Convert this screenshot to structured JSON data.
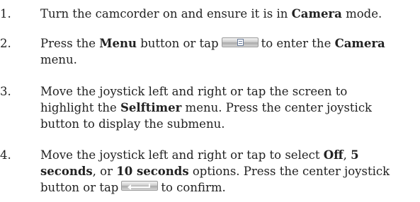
{
  "steps": [
    {
      "number": "1.",
      "line1": {
        "pre": "Turn the camcorder on and ensure it is in ",
        "bold": "Camera",
        "post": " mode."
      }
    },
    {
      "number": "2.",
      "line1": {
        "pre": "Press the ",
        "bold1": "Menu",
        "mid": " button or tap",
        "post": "to enter the ",
        "bold2": "Camera"
      },
      "line2": "menu.",
      "icon": "menu-document-icon"
    },
    {
      "number": "3.",
      "line1": "Move the joystick left and right or tap the screen to",
      "line2": {
        "pre": "highlight the ",
        "bold": "Selftimer",
        "post": " menu. Press the center joystick"
      },
      "line3": "button to display the submenu."
    },
    {
      "number": "4.",
      "line1": {
        "pre": "Move the joystick left and right or tap to select ",
        "bold1": "Off",
        "mid": ", ",
        "bold2": "5"
      },
      "line2": {
        "bold1": "seconds",
        "mid1": ", or ",
        "bold2": "10 seconds",
        "post": " options. Press the center joystick"
      },
      "line3": {
        "pre": "button or tap",
        "post": "to confirm."
      },
      "icon": "enter-arrow-icon"
    }
  ]
}
